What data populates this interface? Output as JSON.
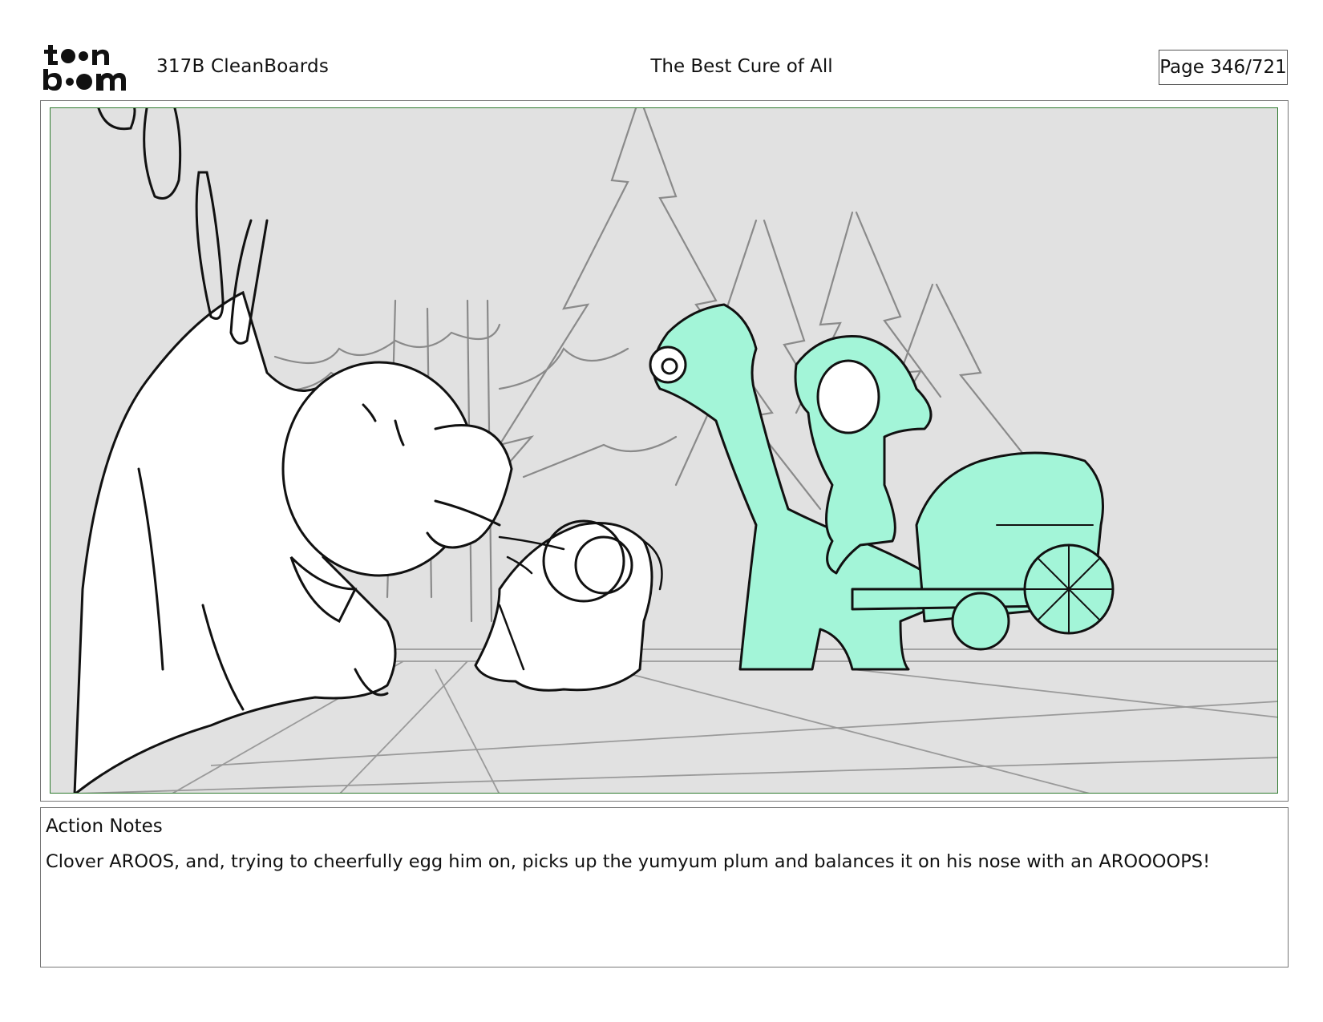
{
  "header": {
    "logo_text": "toon boom",
    "project": "317B  CleanBoards",
    "title": "The Best Cure of All",
    "page": "Page 346/721"
  },
  "notes": {
    "label": "Action Notes",
    "text": "Clover AROOS, and, trying to cheerfully egg him on, picks up the yumyum plum and balances it on his nose with an AROOOOPS!"
  },
  "colors": {
    "background_gray": "#e1e1e1",
    "safe_frame_green": "#2f7a2f",
    "character_mint": "#a3f5d8"
  }
}
